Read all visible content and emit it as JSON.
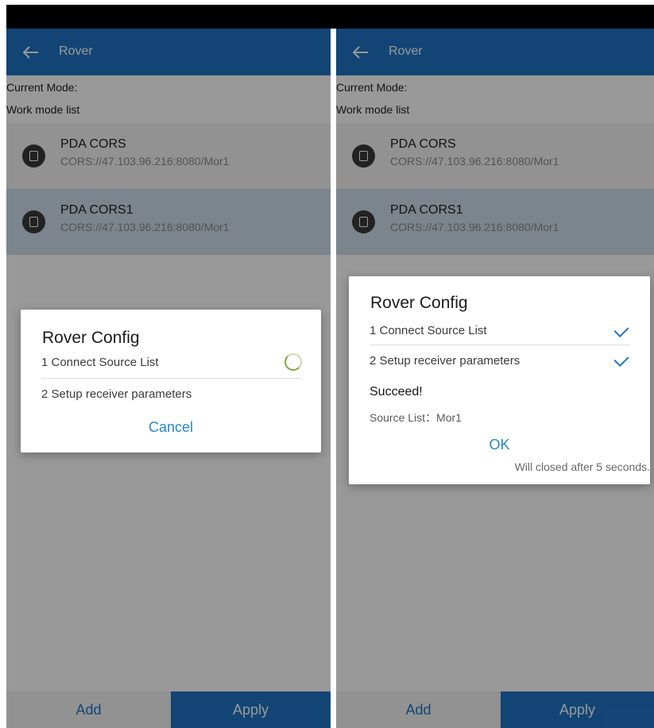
{
  "screens": [
    {
      "appbar": {
        "title": "Rover"
      },
      "current_mode_label": "Current Mode:",
      "work_mode_list_label": "Work mode list",
      "items": [
        {
          "name": "PDA CORS",
          "url": "CORS://47.103.96.216:8080/Mor1",
          "icon": "device-icon"
        },
        {
          "name": "PDA CORS1",
          "url": "CORS://47.103.96.216:8080/Mor1",
          "icon": "device-icon",
          "selected": true
        }
      ],
      "dialog": {
        "title": "Rover Config",
        "steps": [
          {
            "label": "1 Connect Source List",
            "status": "loading"
          },
          {
            "label": "2 Setup receiver parameters",
            "status": "pending"
          }
        ],
        "cancel_label": "Cancel"
      },
      "bottom": {
        "add_label": "Add",
        "apply_label": "Apply"
      }
    },
    {
      "appbar": {
        "title": "Rover"
      },
      "current_mode_label": "Current Mode:",
      "work_mode_list_label": "Work mode list",
      "items": [
        {
          "name": "PDA CORS",
          "url": "CORS://47.103.96.216:8080/Mor1",
          "icon": "device-icon"
        },
        {
          "name": "PDA CORS1",
          "url": "CORS://47.103.96.216:8080/Mor1",
          "icon": "device-icon",
          "selected": true
        }
      ],
      "dialog": {
        "title": "Rover Config",
        "steps": [
          {
            "label": "1 Connect Source List",
            "status": "done"
          },
          {
            "label": "2 Setup receiver parameters",
            "status": "done"
          }
        ],
        "result": "Succeed!",
        "source_list": "Source List：Mor1",
        "ok_label": "OK",
        "auto_close": "Will closed after 5 seconds."
      },
      "bottom": {
        "add_label": "Add",
        "apply_label": "Apply"
      }
    }
  ],
  "colors": {
    "primary": "#1f73c4",
    "status_bar": "#000000",
    "selected_row": "#cfdceb",
    "scrim": "rgba(0,0,0,0.40)",
    "link": "#2489c7"
  }
}
